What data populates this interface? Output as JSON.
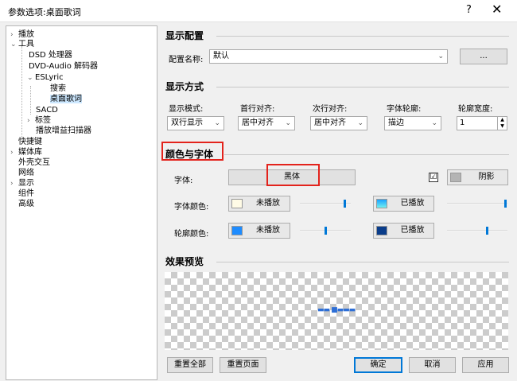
{
  "window": {
    "title": "参数选项:桌面歌词",
    "help_icon": "?",
    "close_icon": "✕"
  },
  "tree": {
    "items": [
      {
        "label": "播放",
        "expander": "›"
      },
      {
        "label": "工具",
        "expander": "⌄"
      },
      {
        "label": "DSD 处理器",
        "expander": ""
      },
      {
        "label": "DVD-Audio 解码器",
        "expander": ""
      },
      {
        "label": "ESLyric",
        "expander": "⌄"
      },
      {
        "label": "搜索",
        "expander": ""
      },
      {
        "label": "桌面歌词",
        "expander": ""
      },
      {
        "label": "SACD",
        "expander": ""
      },
      {
        "label": "标签",
        "expander": "›"
      },
      {
        "label": "播放增益扫描器",
        "expander": ""
      },
      {
        "label": "快捷键",
        "expander": ""
      },
      {
        "label": "媒体库",
        "expander": "›"
      },
      {
        "label": "外壳交互",
        "expander": ""
      },
      {
        "label": "网络",
        "expander": ""
      },
      {
        "label": "显示",
        "expander": "›"
      },
      {
        "label": "组件",
        "expander": ""
      },
      {
        "label": "高级",
        "expander": ""
      }
    ]
  },
  "display_config": {
    "heading": "显示配置",
    "name_label": "配置名称:",
    "name_value": "默认",
    "more_button": "..."
  },
  "display_mode": {
    "heading": "显示方式",
    "columns": [
      {
        "label": "显示模式:",
        "value": "双行显示"
      },
      {
        "label": "首行对齐:",
        "value": "居中对齐"
      },
      {
        "label": "次行对齐:",
        "value": "居中对齐"
      },
      {
        "label": "字体轮廓:",
        "value": "描边"
      },
      {
        "label": "轮廓宽度:",
        "value": "1"
      }
    ]
  },
  "color_font": {
    "heading": "颜色与字体",
    "font_label": "字体:",
    "font_value": "黑体",
    "shadow_checked": "☑",
    "shadow_label": "阴影",
    "font_color_label": "字体颜色:",
    "outline_color_label": "轮廓颜色:",
    "unplayed_label": "未播放",
    "played_label": "已播放",
    "sliders": {
      "font_unplayed": 0.97,
      "font_played": 0.99,
      "outline_unplayed": 0.49,
      "outline_played": 0.66
    },
    "colors": {
      "font_unplayed": "#fffbe6",
      "font_played_top": "#1ba1ff",
      "font_played_bottom": "#72f0f0",
      "outline_unplayed": "#1e8cff",
      "outline_played": "#0a3d8a",
      "shadow": "#b4b4b4"
    }
  },
  "preview": {
    "heading": "效果预览",
    "sample_text": "▬▬ ■▬▬▬"
  },
  "footer": {
    "reset_all": "重置全部",
    "reset_page": "重置页面",
    "ok": "确定",
    "cancel": "取消",
    "apply": "应用"
  },
  "highlight_color": "#e3231c"
}
